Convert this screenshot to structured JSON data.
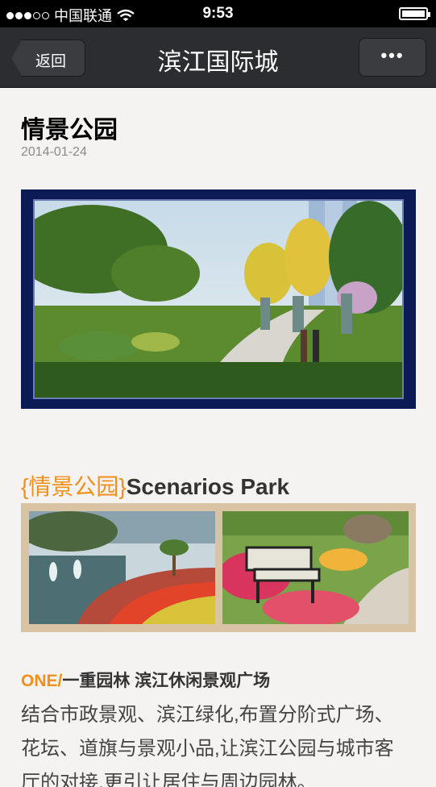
{
  "status_bar": {
    "carrier": "中国联通",
    "time": "9:53"
  },
  "nav": {
    "back_label": "返回",
    "title": "滨江国际城",
    "more_label": "•••"
  },
  "article": {
    "title": "情景公园",
    "date": "2014-01-24",
    "section_cn": "{情景公园}",
    "section_en": "Scenarios Park",
    "sub_one": "ONE/",
    "sub_rest": "一重园林 滨江休闲景观广场",
    "body": "结合市政景观、滨江绿化,布置分阶式广场、花坛、道旗与景观小品,让滨江公园与城市客厅的对接,更引让居住与周边园林。"
  }
}
